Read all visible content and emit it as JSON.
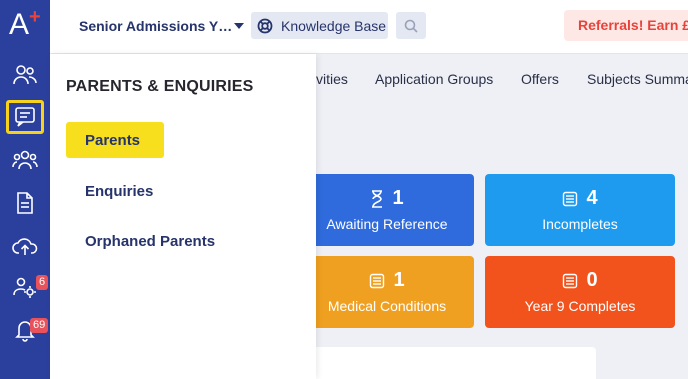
{
  "sidebar": {
    "logo_text": "A",
    "logo_plus": "+",
    "items": [
      {
        "icon": "users-icon"
      },
      {
        "icon": "chat-icon",
        "active": true
      },
      {
        "icon": "group-icon"
      },
      {
        "icon": "document-icon"
      },
      {
        "icon": "cloud-upload-icon"
      },
      {
        "icon": "users-settings-icon",
        "badge": "6"
      },
      {
        "icon": "bell-icon",
        "badge": "69"
      }
    ]
  },
  "header": {
    "title": "Senior Admissions Y…",
    "knowledge_base": "Knowledge Base",
    "referrals": "Referrals! Earn £"
  },
  "tabs": [
    "vities",
    "Application Groups",
    "Offers",
    "Subjects Summa"
  ],
  "cards": [
    {
      "number": "1",
      "label": "Awaiting Reference",
      "icon": "hourglass-icon",
      "color": "#2f6bdc"
    },
    {
      "number": "4",
      "label": "Incompletes",
      "icon": "list-icon",
      "color": "#1e9bef"
    },
    {
      "number": "1",
      "label": "Medical Conditions",
      "icon": "list-icon",
      "color": "#f0a020"
    },
    {
      "number": "0",
      "label": "Year 9 Completes",
      "icon": "list-icon",
      "color": "#f2521b"
    }
  ],
  "flyout": {
    "title": "PARENTS & ENQUIRIES",
    "items": [
      {
        "label": "Parents",
        "active": true
      },
      {
        "label": "Enquiries"
      },
      {
        "label": "Orphaned Parents"
      }
    ]
  }
}
